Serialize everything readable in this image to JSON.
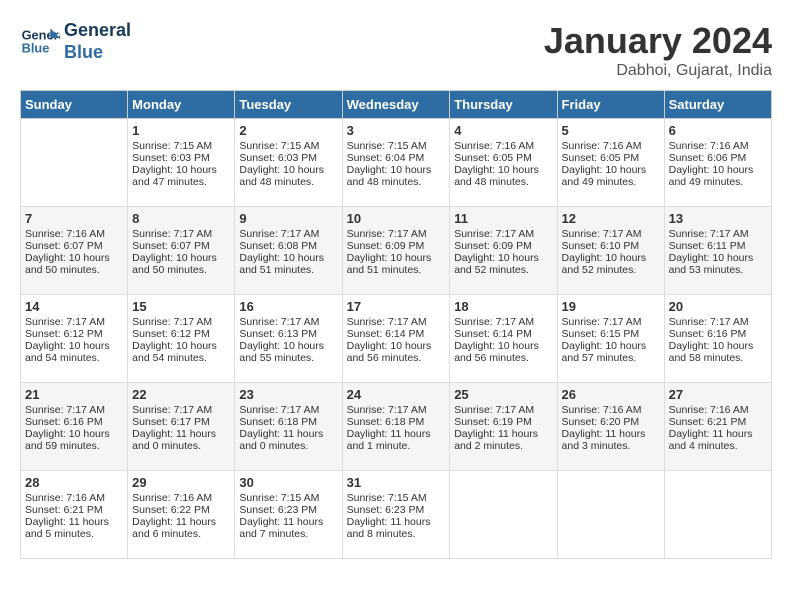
{
  "header": {
    "logo_line1": "General",
    "logo_line2": "Blue",
    "month": "January 2024",
    "location": "Dabhoi, Gujarat, India"
  },
  "weekdays": [
    "Sunday",
    "Monday",
    "Tuesday",
    "Wednesday",
    "Thursday",
    "Friday",
    "Saturday"
  ],
  "weeks": [
    [
      {
        "day": "",
        "info": ""
      },
      {
        "day": "1",
        "info": "Sunrise: 7:15 AM\nSunset: 6:03 PM\nDaylight: 10 hours\nand 47 minutes."
      },
      {
        "day": "2",
        "info": "Sunrise: 7:15 AM\nSunset: 6:03 PM\nDaylight: 10 hours\nand 48 minutes."
      },
      {
        "day": "3",
        "info": "Sunrise: 7:15 AM\nSunset: 6:04 PM\nDaylight: 10 hours\nand 48 minutes."
      },
      {
        "day": "4",
        "info": "Sunrise: 7:16 AM\nSunset: 6:05 PM\nDaylight: 10 hours\nand 48 minutes."
      },
      {
        "day": "5",
        "info": "Sunrise: 7:16 AM\nSunset: 6:05 PM\nDaylight: 10 hours\nand 49 minutes."
      },
      {
        "day": "6",
        "info": "Sunrise: 7:16 AM\nSunset: 6:06 PM\nDaylight: 10 hours\nand 49 minutes."
      }
    ],
    [
      {
        "day": "7",
        "info": "Sunrise: 7:16 AM\nSunset: 6:07 PM\nDaylight: 10 hours\nand 50 minutes."
      },
      {
        "day": "8",
        "info": "Sunrise: 7:17 AM\nSunset: 6:07 PM\nDaylight: 10 hours\nand 50 minutes."
      },
      {
        "day": "9",
        "info": "Sunrise: 7:17 AM\nSunset: 6:08 PM\nDaylight: 10 hours\nand 51 minutes."
      },
      {
        "day": "10",
        "info": "Sunrise: 7:17 AM\nSunset: 6:09 PM\nDaylight: 10 hours\nand 51 minutes."
      },
      {
        "day": "11",
        "info": "Sunrise: 7:17 AM\nSunset: 6:09 PM\nDaylight: 10 hours\nand 52 minutes."
      },
      {
        "day": "12",
        "info": "Sunrise: 7:17 AM\nSunset: 6:10 PM\nDaylight: 10 hours\nand 52 minutes."
      },
      {
        "day": "13",
        "info": "Sunrise: 7:17 AM\nSunset: 6:11 PM\nDaylight: 10 hours\nand 53 minutes."
      }
    ],
    [
      {
        "day": "14",
        "info": "Sunrise: 7:17 AM\nSunset: 6:12 PM\nDaylight: 10 hours\nand 54 minutes."
      },
      {
        "day": "15",
        "info": "Sunrise: 7:17 AM\nSunset: 6:12 PM\nDaylight: 10 hours\nand 54 minutes."
      },
      {
        "day": "16",
        "info": "Sunrise: 7:17 AM\nSunset: 6:13 PM\nDaylight: 10 hours\nand 55 minutes."
      },
      {
        "day": "17",
        "info": "Sunrise: 7:17 AM\nSunset: 6:14 PM\nDaylight: 10 hours\nand 56 minutes."
      },
      {
        "day": "18",
        "info": "Sunrise: 7:17 AM\nSunset: 6:14 PM\nDaylight: 10 hours\nand 56 minutes."
      },
      {
        "day": "19",
        "info": "Sunrise: 7:17 AM\nSunset: 6:15 PM\nDaylight: 10 hours\nand 57 minutes."
      },
      {
        "day": "20",
        "info": "Sunrise: 7:17 AM\nSunset: 6:16 PM\nDaylight: 10 hours\nand 58 minutes."
      }
    ],
    [
      {
        "day": "21",
        "info": "Sunrise: 7:17 AM\nSunset: 6:16 PM\nDaylight: 10 hours\nand 59 minutes."
      },
      {
        "day": "22",
        "info": "Sunrise: 7:17 AM\nSunset: 6:17 PM\nDaylight: 11 hours\nand 0 minutes."
      },
      {
        "day": "23",
        "info": "Sunrise: 7:17 AM\nSunset: 6:18 PM\nDaylight: 11 hours\nand 0 minutes."
      },
      {
        "day": "24",
        "info": "Sunrise: 7:17 AM\nSunset: 6:18 PM\nDaylight: 11 hours\nand 1 minute."
      },
      {
        "day": "25",
        "info": "Sunrise: 7:17 AM\nSunset: 6:19 PM\nDaylight: 11 hours\nand 2 minutes."
      },
      {
        "day": "26",
        "info": "Sunrise: 7:16 AM\nSunset: 6:20 PM\nDaylight: 11 hours\nand 3 minutes."
      },
      {
        "day": "27",
        "info": "Sunrise: 7:16 AM\nSunset: 6:21 PM\nDaylight: 11 hours\nand 4 minutes."
      }
    ],
    [
      {
        "day": "28",
        "info": "Sunrise: 7:16 AM\nSunset: 6:21 PM\nDaylight: 11 hours\nand 5 minutes."
      },
      {
        "day": "29",
        "info": "Sunrise: 7:16 AM\nSunset: 6:22 PM\nDaylight: 11 hours\nand 6 minutes."
      },
      {
        "day": "30",
        "info": "Sunrise: 7:15 AM\nSunset: 6:23 PM\nDaylight: 11 hours\nand 7 minutes."
      },
      {
        "day": "31",
        "info": "Sunrise: 7:15 AM\nSunset: 6:23 PM\nDaylight: 11 hours\nand 8 minutes."
      },
      {
        "day": "",
        "info": ""
      },
      {
        "day": "",
        "info": ""
      },
      {
        "day": "",
        "info": ""
      }
    ]
  ]
}
